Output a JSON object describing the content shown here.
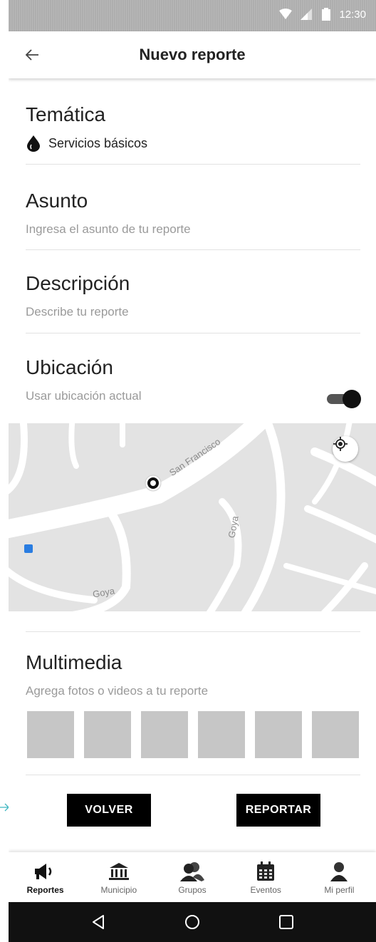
{
  "status_bar": {
    "time": "12:30"
  },
  "app_bar": {
    "title": "Nuevo reporte",
    "back_icon": "arrow-left-icon"
  },
  "topic": {
    "title": "Temática",
    "value": "Servicios básicos",
    "icon": "water-drop-icon"
  },
  "subject": {
    "title": "Asunto",
    "placeholder": "Ingresa el asunto de tu reporte"
  },
  "description": {
    "title": "Descripción",
    "placeholder": "Describe tu reporte"
  },
  "location": {
    "title": "Ubicación",
    "toggle_label": "Usar ubicación actual",
    "use_current": true,
    "streets": [
      "San Francisco",
      "Goya",
      "Goya"
    ]
  },
  "multimedia": {
    "title": "Multimedia",
    "subtitle": "Agrega fotos o videos a tu reporte",
    "slots": 6
  },
  "actions": {
    "back_label": "VOLVER",
    "report_label": "REPORTAR"
  },
  "bottom_nav": [
    {
      "label": "Reportes",
      "icon": "megaphone-icon",
      "active": true
    },
    {
      "label": "Municipio",
      "icon": "building-icon",
      "active": false
    },
    {
      "label": "Grupos",
      "icon": "group-icon",
      "active": false
    },
    {
      "label": "Eventos",
      "icon": "calendar-icon",
      "active": false
    },
    {
      "label": "Mi perfil",
      "icon": "person-icon",
      "active": false
    }
  ],
  "colors": {
    "primary": "#000000",
    "placeholder": "#9a9a9a",
    "map_bg": "#e3e3e3",
    "thumb": "#c6c6c6"
  }
}
